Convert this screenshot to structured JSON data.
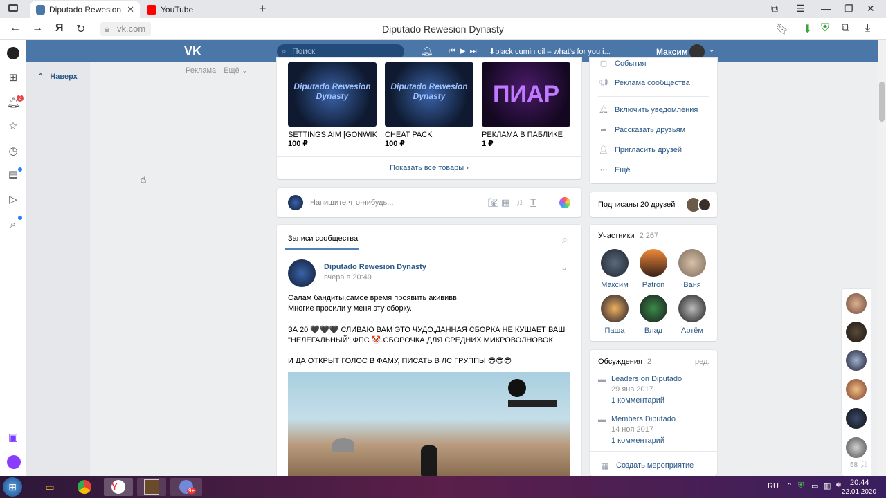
{
  "browser": {
    "tabs": [
      {
        "label": "Diputado Rewesion Dyna",
        "favicon_color": "#4a76a8"
      },
      {
        "label": "YouTube",
        "favicon_color": "#ff0000"
      }
    ],
    "new_tab": "+",
    "url": "vk.com",
    "page_title": "Diputado Rewesion Dynasty"
  },
  "vk": {
    "search_placeholder": "Поиск",
    "track": "⬇black cumin oil – what's for you i...",
    "user_name": "Максим",
    "back_to_top": "Наверх",
    "ads_label": "Реклама",
    "more_label": "Ещё ⌄"
  },
  "products": [
    {
      "name": "SETTINGS AIM [GONWIK/R...",
      "price": "100 ₽",
      "art": "Diputado Rewesion Dynasty"
    },
    {
      "name": "CHEAT PACK",
      "price": "100 ₽",
      "art": "Diputado Rewesion Dynasty"
    },
    {
      "name": "РЕКЛАМА В ПАБЛИКЕ",
      "price": "1 ₽",
      "art": "ПИАР"
    }
  ],
  "show_all_products": "Показать все товары ›",
  "composer_placeholder": "Напишите что-нибудь...",
  "posts_tab": "Записи сообщества",
  "post": {
    "author": "Diputado Rewesion Dynasty",
    "time": "вчера в 20:49",
    "lines": [
      "Салам бандиты,самое время проявить акививв.",
      "Многие просили у меня эту сборку.",
      "",
      "ЗА 20 🖤🖤🖤 СЛИВАЮ ВАМ ЭТО ЧУДО,ДАННАЯ СБОРКА НЕ КУШАЕТ ВАШ",
      "\"НЕЛЕГАЛЬНЫЙ\" ФПС 🤡.СБОРОЧКА ДЛЯ СРЕДНИХ МИКРОВОЛНОВОК.",
      "",
      "И ДА ОТКРЫТ ГОЛОС В ФАМУ, ПИСАТЬ В ЛС ГРУППЫ 😎😎😎"
    ]
  },
  "right_menu": [
    {
      "label": "События",
      "icon": "calendar-icon"
    },
    {
      "label": "Реклама сообщества",
      "icon": "megaphone-icon"
    },
    {
      "label": "Включить уведомления",
      "icon": "bell-icon"
    },
    {
      "label": "Рассказать друзьям",
      "icon": "share-icon"
    },
    {
      "label": "Пригласить друзей",
      "icon": "add-user-icon"
    },
    {
      "label": "Ещё",
      "icon": "more-icon"
    }
  ],
  "friends_subscribed": "Подписаны 20 друзей",
  "members": {
    "title": "Участники",
    "count": "2 267",
    "list": [
      "Максим",
      "Patron",
      "Ваня",
      "Паша",
      "Влад",
      "Артём"
    ]
  },
  "discussions": {
    "title": "Обсуждения",
    "count": "2",
    "edit": "ред.",
    "items": [
      {
        "title": "Leaders on Diputado",
        "date": "29 янв 2017",
        "comments": "1 комментарий"
      },
      {
        "title": "Members Diputado",
        "date": "14 ноя 2017",
        "comments": "1 комментарий"
      }
    ],
    "create_event": "Создать мероприятие"
  },
  "online_friends_count": "58",
  "taskbar": {
    "lang": "RU",
    "time": "20:44",
    "date": "22.01.2020",
    "discord_badge": "9+"
  },
  "notifications_badge": "2"
}
